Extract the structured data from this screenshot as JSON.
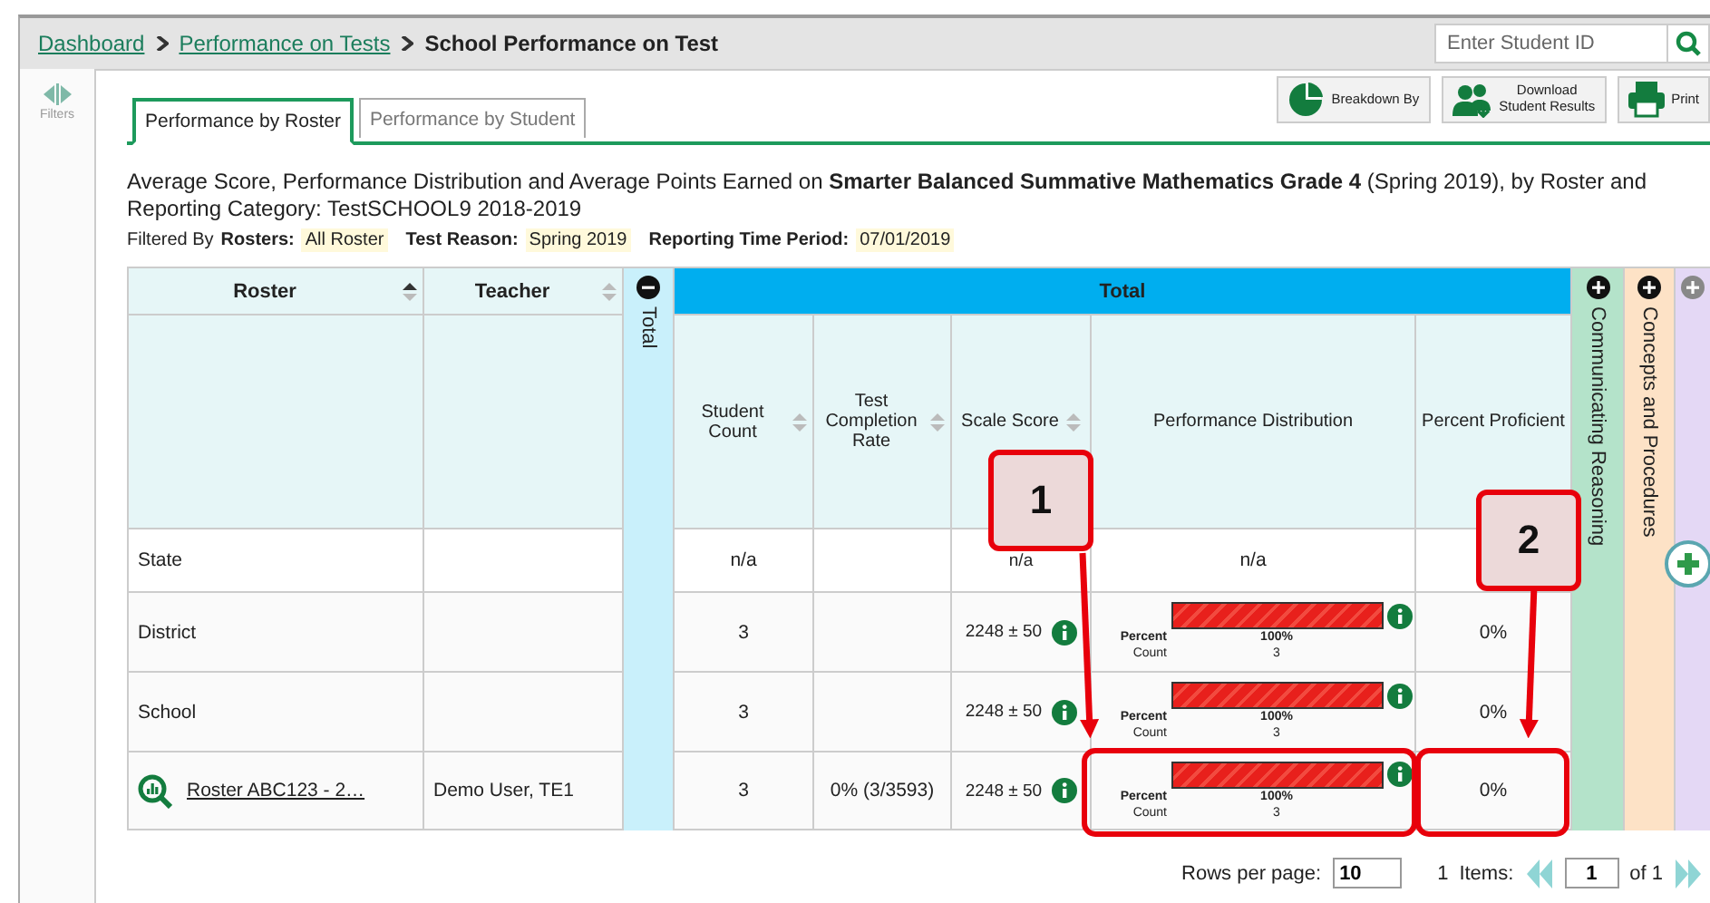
{
  "breadcrumbs": [
    {
      "label": "Dashboard",
      "link": true
    },
    {
      "label": "Performance on Tests",
      "link": true
    },
    {
      "label": "School Performance on Test",
      "link": false
    }
  ],
  "search": {
    "placeholder": "Enter Student ID"
  },
  "sidebar": {
    "label": "Filters"
  },
  "tabs": [
    {
      "label": "Performance by Roster",
      "selected": true
    },
    {
      "label": "Performance by Student",
      "selected": false
    }
  ],
  "toolbar": [
    {
      "kind": "pie",
      "lines": [
        "Breakdown By"
      ]
    },
    {
      "kind": "download",
      "lines": [
        "Download",
        "Student Results"
      ]
    },
    {
      "kind": "print",
      "lines": [
        "Print"
      ]
    }
  ],
  "description": "Average Score, Performance Distribution and Average Points Earned on **Smarter Balanced Summative Mathematics Grade 4** (Spring 2019), by Roster and Reporting Category: TestSCHOOL9 2018-2019",
  "filters": {
    "prefix": "Filtered By",
    "items": [
      {
        "label": "Rosters:",
        "value": "All Roster"
      },
      {
        "label": "Test Reason:",
        "value": "Spring 2019"
      },
      {
        "label": "Reporting Time Period:",
        "value": "07/01/2019"
      }
    ]
  },
  "table": {
    "columns": [
      {
        "label": "Roster",
        "sorted": true
      },
      {
        "label": "Teacher",
        "sorted": false
      }
    ],
    "groups": [
      {
        "label": "Total",
        "header": "Total",
        "expanded": true,
        "color": "#c9f0fb",
        "columns": [
          {
            "label": "Student Count",
            "sorted": false
          },
          {
            "label": "Test Completion Rate",
            "sorted": false
          },
          {
            "label": "Scale Score",
            "sorted": false
          },
          {
            "label": "Performance Distribution"
          },
          {
            "label": "Percent Proficient"
          }
        ]
      },
      {
        "label": "Communicating Reasoning",
        "expanded": false,
        "color": "#b4e3ca"
      },
      {
        "label": "Concepts and Procedures",
        "expanded": false,
        "color": "#fde2c6"
      },
      {
        "expanded": false,
        "color": "#e4d8f5"
      }
    ],
    "rows": [
      {
        "kind": "aggregate",
        "name": "State",
        "student_count": "n/a",
        "scale_score": "n/a",
        "distribution": {
          "kind": "text",
          "text": "n/a"
        }
      },
      {
        "kind": "aggregate",
        "name": "District",
        "student_count": "3",
        "scale_score": "2248 ± 50",
        "distribution": {
          "kind": "bar",
          "level": 1,
          "percent_label": "Percent",
          "percent": "100%",
          "count_label": "Count",
          "count": "3"
        },
        "percent_proficient": "0%"
      },
      {
        "kind": "aggregate",
        "name": "School",
        "student_count": "3",
        "scale_score": "2248 ± 50",
        "distribution": {
          "kind": "bar",
          "level": 1,
          "percent_label": "Percent",
          "percent": "100%",
          "count_label": "Count",
          "count": "3"
        },
        "percent_proficient": "0%"
      },
      {
        "kind": "roster",
        "name": "Roster ABC123 - 2…",
        "teacher": "Demo User, TE1",
        "student_count": "3",
        "completion": "0% (3/3593)",
        "scale_score": "2248 ± 50",
        "distribution": {
          "kind": "bar",
          "level": 1,
          "percent_label": "Percent",
          "percent": "100%",
          "count_label": "Count",
          "count": "3"
        },
        "percent_proficient": "0%"
      }
    ]
  },
  "pagination": {
    "rows_label": "Rows per page:",
    "rows_per_page": "10",
    "count": "1",
    "items_label": "Items:",
    "page": "1",
    "of_label": "of 1"
  },
  "annotations": [
    {
      "label": "1"
    },
    {
      "label": "2"
    }
  ]
}
